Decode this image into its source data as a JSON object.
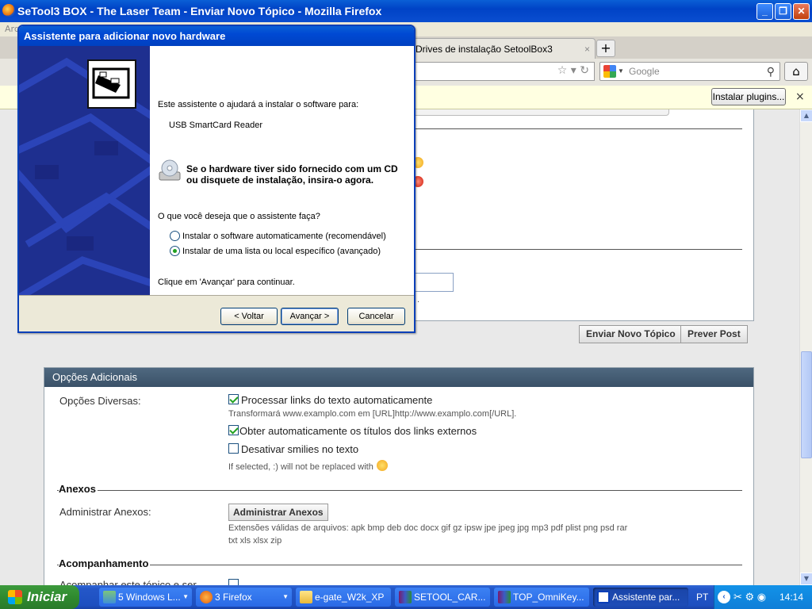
{
  "firefox": {
    "title": "SeTool3 BOX - The Laser Team - Enviar Novo Tópico - Mozilla Firefox",
    "menu_first": "Arq",
    "tab_label": "Drives de instalação SetoolBox3",
    "tab_close": "×",
    "new_tab": "+",
    "search_placeholder": "Google",
    "plugin_button": "Instalar plugins...",
    "plugin_close": "×"
  },
  "page": {
    "send_button": "Enviar Novo Tópico",
    "preview_button": "Prever Post",
    "options_header": "Opções Adicionais",
    "misc_label": "Opções Diversas:",
    "opt1_label": "Processar links do texto automaticamente",
    "opt1_checked": true,
    "opt1_desc": "Transformará www.examplo.com em [URL]http://www.examplo.com[/URL].",
    "opt2_label": "Obter automaticamente os títulos dos links externos",
    "opt2_checked": true,
    "opt3_label": "Desativar smilies no texto",
    "opt3_checked": false,
    "opt3_desc": "If selected, :) will not be replaced with",
    "attachments_title": "Anexos",
    "manage_label": "Administrar Anexos:",
    "manage_button": "Administrar Anexos",
    "extensions_line1": "Extensões válidas de arquivos: apk bmp deb doc docx gif gz ipsw jpe jpeg jpg mp3 pdf plist png psd rar",
    "extensions_line2": "txt xls xlsx zip",
    "follow_title": "Acompanhamento",
    "follow_label": "Acompanhar este tópico e ser",
    "partial_char": "."
  },
  "wizard": {
    "title": "Assistente para adicionar novo hardware",
    "intro": "Este assistente o ajudará a instalar o software para:",
    "device": "USB SmartCard Reader",
    "cd_line1": "Se o hardware tiver sido fornecido com um CD",
    "cd_line2": "ou disquete de instalação, insira-o agora.",
    "question": "O que você deseja que o assistente faça?",
    "option_auto": "Instalar o software automaticamente (recomendável)",
    "option_list": "Instalar de uma lista ou local específico (avançado)",
    "selected_option": "option_list",
    "continue_hint": "Clique em 'Avançar' para continuar.",
    "back_button": "< Voltar",
    "next_button": "Avançar >",
    "cancel_button": "Cancelar"
  },
  "taskbar": {
    "start": "Iniciar",
    "items": [
      {
        "label": "5 Windows L...",
        "icon": "windows-live-icon"
      },
      {
        "label": "3 Firefox",
        "icon": "firefox-icon"
      },
      {
        "label": "e-gate_W2k_XP",
        "icon": "folder-icon"
      },
      {
        "label": "SETOOL_CAR...",
        "icon": "winrar-icon"
      },
      {
        "label": "TOP_OmniKey...",
        "icon": "winrar-icon"
      },
      {
        "label": "Assistente par...",
        "icon": "wizard-window-icon"
      }
    ],
    "language": "PT",
    "clock": "14:14"
  },
  "colors": {
    "xp_blue": "#0a5fd6",
    "start_green": "#2f8a2f",
    "wizard_side": "#1e2f8f",
    "options_header": "#3a5168"
  }
}
